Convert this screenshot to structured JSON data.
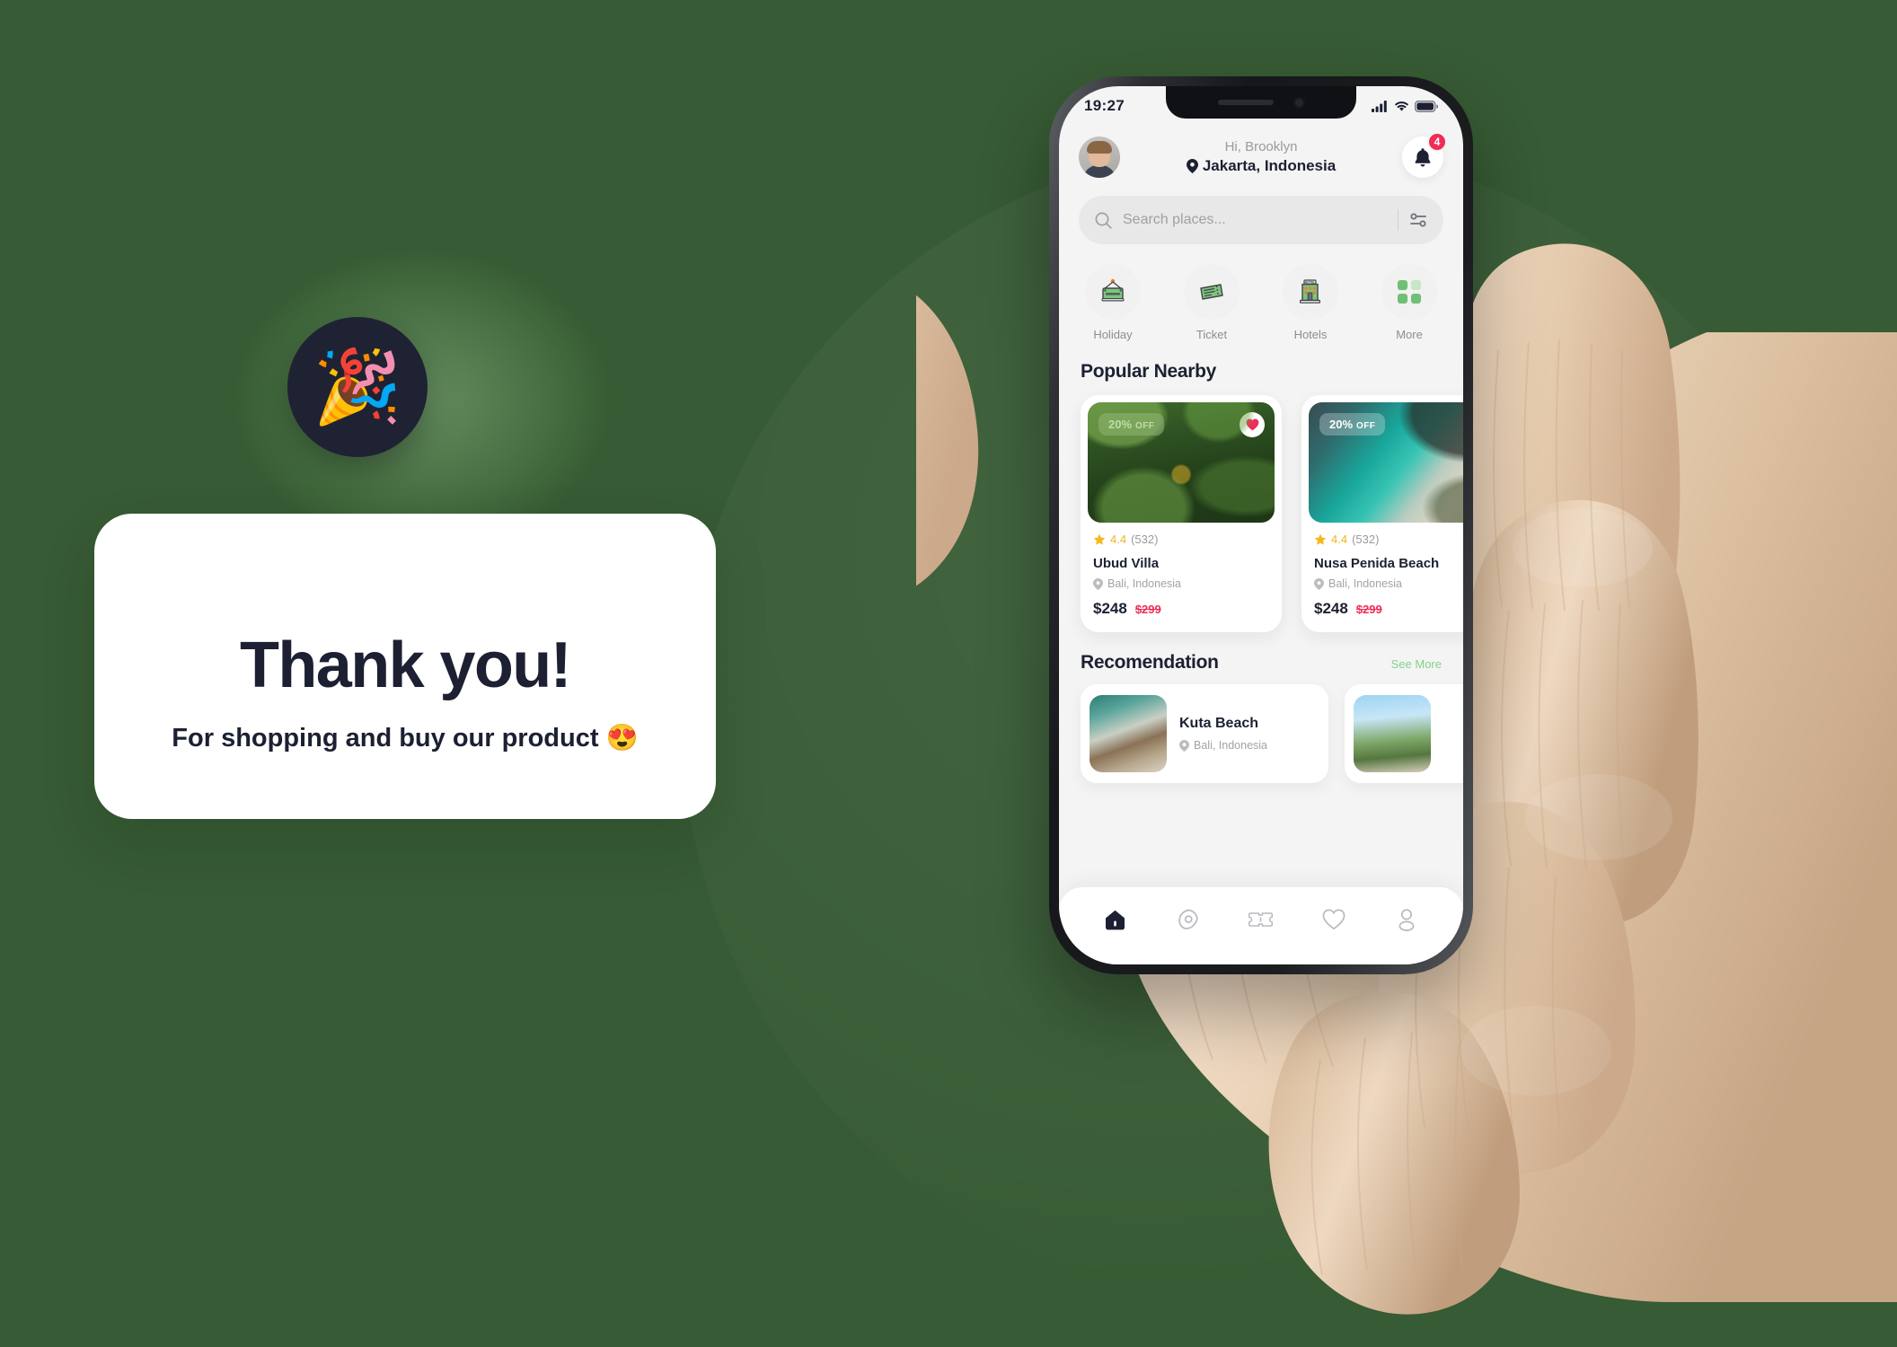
{
  "background": {
    "color": "#375b34"
  },
  "thank_you_card": {
    "emoji": "🎉",
    "emoji_name": "party-popper-emoji",
    "title": "Thank you!",
    "subtitle": "For shopping and buy our product 😍"
  },
  "phone": {
    "status_bar": {
      "time": "19:27",
      "signal_icon": "cellular-signal-icon",
      "wifi_icon": "wifi-icon",
      "battery_icon": "battery-icon"
    },
    "header": {
      "avatar_name": "user-avatar",
      "greeting": "Hi, Brooklyn",
      "location": "Jakarta, Indonesia",
      "location_icon": "map-pin-icon",
      "bell_icon": "notification-bell-icon",
      "bell_badge": "4"
    },
    "search": {
      "placeholder": "Search places...",
      "search_icon": "search-icon",
      "filter_icon": "filter-sliders-icon"
    },
    "categories": [
      {
        "label": "Holiday",
        "icon": "holiday-sign-icon"
      },
      {
        "label": "Ticket",
        "icon": "ticket-stack-icon"
      },
      {
        "label": "Hotels",
        "icon": "hotel-building-icon"
      },
      {
        "label": "More",
        "icon": "grid-more-icon"
      }
    ],
    "popular": {
      "title": "Popular Nearby",
      "cards": [
        {
          "discount_value": "20%",
          "discount_unit": "OFF",
          "favorited": true,
          "rating": "4.4",
          "reviews": "(532)",
          "name": "Ubud Villa",
          "location": "Bali, Indonesia",
          "price": "$248",
          "old_price": "$299",
          "image": "ubud-villa-photo"
        },
        {
          "discount_value": "20%",
          "discount_unit": "OFF",
          "favorited": false,
          "rating": "4.4",
          "reviews": "(532)",
          "name": "Nusa Penida Beach",
          "location": "Bali, Indonesia",
          "price": "$248",
          "old_price": "$299",
          "image": "nusa-penida-beach-photo"
        }
      ]
    },
    "recommendation": {
      "title": "Recomendation",
      "see_more": "See More",
      "see_more_color": "#84d18b",
      "cards": [
        {
          "name": "Kuta Beach",
          "location": "Bali, Indonesia",
          "image": "kuta-beach-photo"
        },
        {
          "name": "",
          "location": "",
          "image": "next-place-photo"
        }
      ]
    },
    "bottom_nav": [
      {
        "icon": "home-icon",
        "active": true
      },
      {
        "icon": "explore-compass-icon",
        "active": false
      },
      {
        "icon": "ticket-icon",
        "active": false
      },
      {
        "icon": "heart-icon",
        "active": false
      },
      {
        "icon": "profile-person-icon",
        "active": false
      }
    ]
  }
}
